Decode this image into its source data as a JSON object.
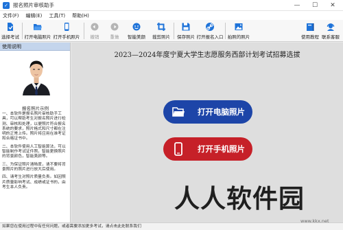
{
  "window": {
    "title": "报名照片审核助手",
    "minimize": "—",
    "maximize": "☐",
    "close": "✕"
  },
  "menu": [
    "文件(F)",
    "编辑(E)",
    "工具(T)",
    "帮助(H)"
  ],
  "toolbar": {
    "items": [
      {
        "label": "选择考试",
        "icon": "select-exam-icon",
        "enabled": true
      },
      {
        "label": "打开电脑照片",
        "icon": "folder-open-icon",
        "enabled": true
      },
      {
        "label": "打开手机照片",
        "icon": "phone-icon",
        "enabled": true
      },
      {
        "label": "撤销",
        "icon": "undo-icon",
        "enabled": false
      },
      {
        "label": "重做",
        "icon": "redo-icon",
        "enabled": false
      },
      {
        "label": "智能美颜",
        "icon": "beauty-icon",
        "enabled": true
      },
      {
        "label": "裁剪照片",
        "icon": "crop-icon",
        "enabled": true
      },
      {
        "label": "保存照片",
        "icon": "save-icon",
        "enabled": true
      },
      {
        "label": "打开报名入口",
        "icon": "link-icon",
        "enabled": true
      },
      {
        "label": "拍照的照片",
        "icon": "photo-icon",
        "enabled": true
      },
      {
        "label": "使用教程",
        "icon": "book-icon",
        "enabled": true
      },
      {
        "label": "联系客服",
        "icon": "headset-icon",
        "enabled": true
      }
    ]
  },
  "left_panel": {
    "header": "使用说明",
    "photo_caption": "报名照片示例",
    "paragraphs": [
      "一、本软件是报名照片审核助手工具，可以帮助考生对报名照片进行检测、审核和处理，以便照片符合报名系统的要求，照片格式和尺寸都在注明的正常上传。照片将应用在准考证和合格证书中。",
      "二、本软件使用人工智能算法，可以智能制作考试证件照，智能更换照片的背景颜色，智能美颜等。",
      "三、为保证照片清晰度，请不要将背景照片的照片进行放大后使用。",
      "四、请考生对照片质量负责。如因照片质量影响考试、成绩或证书的，由考生本人负责。"
    ]
  },
  "main": {
    "title": "2023—2024年度宁夏大学生志愿服务西部计划考试招募选拔",
    "btn_pc": "打开电脑照片",
    "btn_phone": "打开手机照片"
  },
  "watermark": {
    "text": "人人软件园",
    "url": "www.kkx.net"
  },
  "status": "如果您在使用过程中有任何问题，或者需要添加更多考试，请点击此处联系我们"
}
